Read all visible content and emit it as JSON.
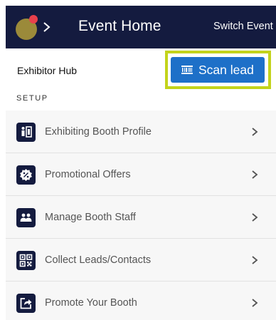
{
  "header": {
    "title": "Event Home",
    "switch_event_label": "Switch Event",
    "logo_icon": "event-logo-icon",
    "background_color": "#141b3f"
  },
  "hub": {
    "title": "Exhibitor Hub",
    "scan_button_label": "Scan lead",
    "scan_button_icon": "barcode-scan-icon",
    "scan_button_color": "#1e70c8",
    "highlight_color": "#c3d31b"
  },
  "section": {
    "label": "SETUP"
  },
  "items": [
    {
      "label": "Exhibiting Booth Profile",
      "icon": "booth-profile-icon"
    },
    {
      "label": "Promotional Offers",
      "icon": "promo-badge-icon"
    },
    {
      "label": "Manage Booth Staff",
      "icon": "staff-group-icon"
    },
    {
      "label": "Collect Leads/Contacts",
      "icon": "qr-code-icon"
    },
    {
      "label": "Promote Your Booth",
      "icon": "share-arrow-icon"
    }
  ]
}
